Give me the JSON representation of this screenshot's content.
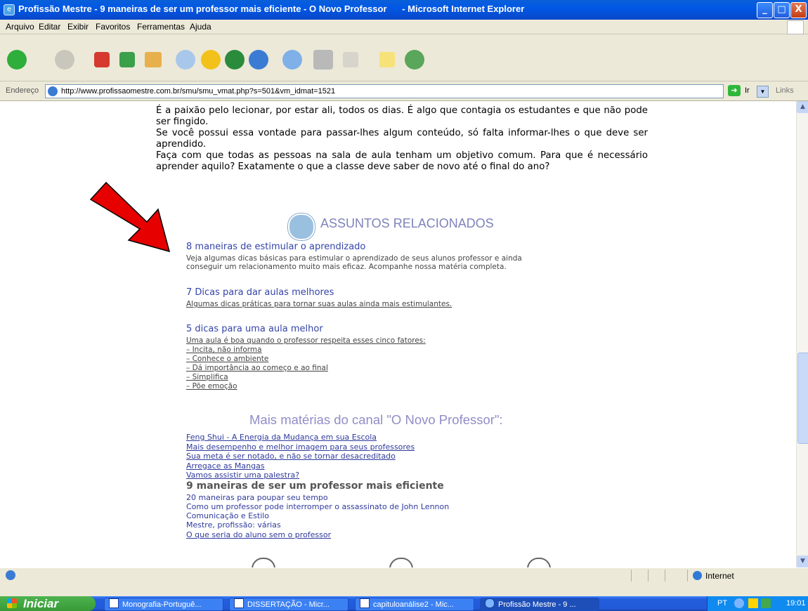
{
  "window": {
    "title": "Profissão Mestre - 9 maneiras de ser um professor mais eficiente - O Novo Professor      - Microsoft Internet Explorer",
    "minimize": "_",
    "maximize": "□",
    "close": "X"
  },
  "menu": [
    "Arquivo",
    "Editar",
    "Exibir",
    "Favoritos",
    "Ferramentas",
    "Ajuda"
  ],
  "toolbar_icons": [
    "back-icon",
    "forward-icon",
    "stop-icon",
    "refresh-icon",
    "home-icon",
    "search-icon",
    "favorites-icon",
    "media-icon",
    "history-icon",
    "mail-icon",
    "print-icon",
    "edit-icon",
    "discuss-icon",
    "messenger-icon"
  ],
  "address": {
    "label": "Endereço",
    "url": "http://www.profissaomestre.com.br/smu/smu_vmat.php?s=501&vm_idmat=1521",
    "go": "Ir",
    "links": "Links"
  },
  "article": {
    "p1": "É a paixão pelo lecionar, por estar ali, todos os dias. É algo que contagia os estudantes e que não pode ser fingido.",
    "p2": "Se você possui essa vontade para passar-lhes algum conteúdo, só falta informar-lhes o que deve ser aprendido.",
    "p3": "Faça com que todas as pessoas na sala de aula tenham um objetivo comum. Para que é necessário aprender aquilo? Exatamente o que a classe deve saber de novo até o final do ano?"
  },
  "related": {
    "heading": "ASSUNTOS RELACIONADOS",
    "items": [
      {
        "title": "8 maneiras de estimular o aprendizado",
        "desc": [
          "Veja algumas dicas básicas para estimular o aprendizado de seus alunos professor e ainda",
          "conseguir um relacionamento muito mais eficaz. Acompanhe nossa matéria completa."
        ]
      },
      {
        "title": "7 Dicas para dar aulas melhores",
        "desc": [
          "Algumas dicas práticas para tornar suas aulas ainda mais estimulantes."
        ]
      },
      {
        "title": "5 dicas para uma aula melhor",
        "desc": [
          "Uma aula é boa quando o professor respeita esses cinco fatores:",
          "– Incita, não informa",
          "– Conhece o ambiente",
          "– Dá importância ao começo e ao final",
          "– Simplifica",
          "– Põe emoção"
        ]
      }
    ]
  },
  "more": {
    "heading": "Mais matérias do canal \"O Novo Professor\":",
    "links_top": [
      "Feng Shui - A Energia da Mudança em sua Escola",
      "Mais desempenho e melhor imagem para seus professores",
      "Sua meta é ser notado, e não se tornar desacreditado",
      "Arregace as Mangas",
      "Vamos assistir uma palestra?"
    ],
    "current": "9 maneiras de ser um professor mais eficiente",
    "links_bottom": [
      "20 maneiras para poupar seu tempo",
      "Como um professor pode interromper o assassinato de John Lennon",
      "Comunicação e Estilo",
      "Mestre, profissão: várias",
      "O que seria do aluno sem o professor"
    ]
  },
  "status": {
    "zone": "Internet"
  },
  "taskbar": {
    "start": "Iniciar",
    "tasks": [
      "Monografia-Portuguê...",
      "DISSERTAÇÃO - Micr...",
      "capituloanálise2 - Mic...",
      "Profissão Mestre - 9 ..."
    ],
    "lang": "PT",
    "clock": "19:01"
  },
  "colors": {
    "arrow": "#e60000",
    "link": "#3444a8",
    "heading": "#7e83ba"
  }
}
